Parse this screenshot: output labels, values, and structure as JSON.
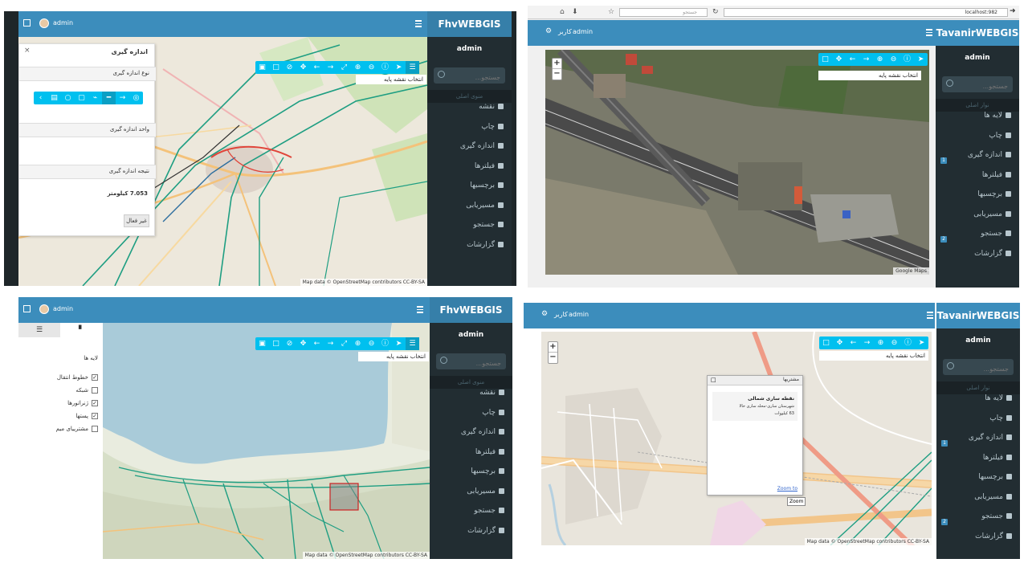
{
  "q1": {
    "brand": "FhvWEBGIS",
    "user": "admin",
    "side_user": "admin",
    "search_placeholder": "جستجو...",
    "menu_header": "منوی اصلی",
    "menu": [
      "نقشه",
      "چاپ",
      "اندازه گیری",
      "فیلترها",
      "برچسبها",
      "مسیریابی",
      "جستجو",
      "گزارشات"
    ],
    "measure": {
      "title": "اندازه گیری",
      "type_label": "نوع اندازه گیری",
      "unit_label": "واحد اندازه گیری",
      "result_label": "نتیجه اندازه گیری",
      "result_value": "7.053 کیلومتر",
      "deactivate": "غیر فعال",
      "close": "×"
    },
    "basemap": "انتخاب نقشه پایه",
    "attribution": "Map data © OpenStreetMap contributors CC-BY-SA"
  },
  "q2": {
    "brand": "TavanirWEBGIS",
    "user": "admin",
    "role": "کاربر",
    "side_user": "admin",
    "search_placeholder": "جستجو...",
    "menu_header": "نوار اصلی",
    "menu": [
      "لایه ها",
      "چاپ",
      "اندازه گیری",
      "فیلترها",
      "برچسبها",
      "مسیریابی",
      "جستجو",
      "گزارشات"
    ],
    "badges": {
      "2": "1",
      "6": "2"
    },
    "basemap": "انتخاب نقشه پایه",
    "attribution": "Google Maps",
    "browser_url": "localhost:982",
    "browser_search": "جستجو"
  },
  "q3": {
    "brand": "FhvWEBGIS",
    "user": "admin",
    "side_user": "admin",
    "search_placeholder": "جستجو...",
    "menu_header": "منوی اصلی",
    "menu": [
      "نقشه",
      "چاپ",
      "اندازه گیری",
      "فیلترها",
      "برچسبها",
      "مسیریابی",
      "جستجو",
      "گزارشات"
    ],
    "layers_title": "لایه ها",
    "layers": [
      {
        "label": "خطوط انتقال",
        "checked": true
      },
      {
        "label": "شبکه",
        "checked": false
      },
      {
        "label": "ژنراتورها",
        "checked": true
      },
      {
        "label": "پستها",
        "checked": true
      },
      {
        "label": "مشترییای میم",
        "checked": false
      }
    ],
    "basemap": "انتخاب نقشه پایه",
    "attribution": "Map data © OpenStreetMap contributors CC-BY-SA"
  },
  "q4": {
    "brand": "TavanirWEBGIS",
    "user": "admin",
    "role": "کاربر",
    "side_user": "admin",
    "search_placeholder": "جستجو...",
    "menu_header": "نوار اصلی",
    "menu": [
      "لایه ها",
      "چاپ",
      "اندازه گیری",
      "فیلترها",
      "برچسبها",
      "مسیریابی",
      "جستجو",
      "گزارشات"
    ],
    "badges": {
      "2": "1",
      "6": "2"
    },
    "basemap": "انتخاب نقشه پایه",
    "popup": {
      "title": "مشتریها",
      "name": "نقطه ساری شمالی",
      "line2": "شهرستان ساری-محله ساری خالا",
      "line3": "63 کیلووات",
      "zoom_link": "Zoom to",
      "tooltip": "Zoom"
    },
    "attribution": "Map data © OpenStreetMap contributors CC-BY-SA"
  },
  "colors": {
    "header": "#3c8dbc",
    "brand_bg": "#367fa9",
    "sidebar": "#222d32",
    "toolbar": "#00c0ef"
  }
}
